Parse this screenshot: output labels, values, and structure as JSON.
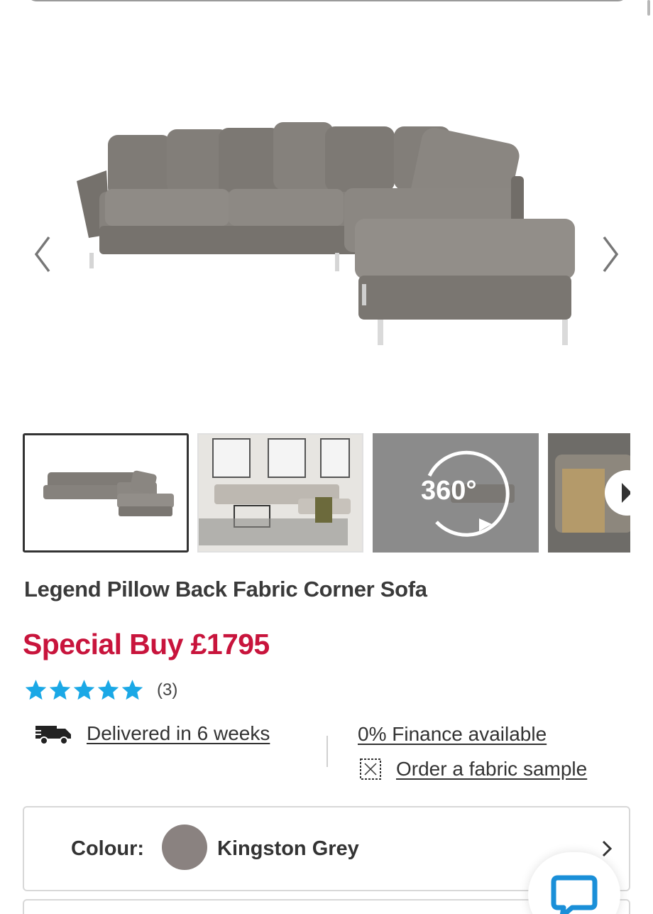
{
  "product": {
    "title": "Legend Pillow Back Fabric Corner Sofa",
    "price_label": "Special Buy £1795",
    "rating": 5,
    "rating_max": 5,
    "review_count": "(3)"
  },
  "gallery": {
    "thumb_360_label": "360°",
    "thumbnail_count_visible": 4
  },
  "info": {
    "delivery_label": "Delivered in 6 weeks",
    "finance_label": "0% Finance available",
    "sample_label": "Order a fabric sample"
  },
  "colour": {
    "label": "Colour:",
    "value": "Kingston Grey",
    "swatch_color": "#8a8280"
  },
  "theme": {
    "price_color": "#c8143c",
    "star_color": "#1aa8e6",
    "chat_color": "#1a8fd8"
  },
  "icons": {
    "prev": "chevron-left-icon",
    "next": "chevron-right-icon",
    "delivery": "delivery-truck-icon",
    "sample": "fabric-swatch-icon",
    "colour_chevron": "chevron-right-icon",
    "chat": "chat-bubble-icon"
  }
}
